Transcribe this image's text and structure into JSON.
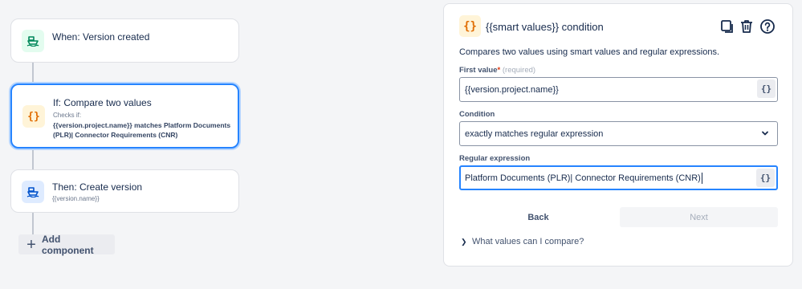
{
  "flow": {
    "trigger": {
      "title": "When: Version created",
      "icon": "version-ship-icon"
    },
    "condition": {
      "title": "If: Compare two values",
      "sub": "Checks if:",
      "desc": "{{version.project.name}} matches Platform Documents (PLR)| Connector Requirements (CNR)",
      "icon": "smart-values-icon",
      "icon_glyph": "{}"
    },
    "action": {
      "title": "Then: Create version",
      "sub": "{{version.name}}",
      "icon": "version-ship-icon"
    },
    "add_component": "Add component"
  },
  "panel": {
    "icon_glyph": "{}",
    "title": "{{smart values}} condition",
    "description": "Compares two values using smart values and regular expressions.",
    "first_value": {
      "label": "First value",
      "required_mark": "*",
      "hint": "(required)",
      "value": "{{version.project.name}}"
    },
    "condition": {
      "label": "Condition",
      "value": "exactly matches regular expression"
    },
    "regex": {
      "label": "Regular expression",
      "value": "Platform Documents (PLR)| Connector Requirements (CNR)"
    },
    "smart_button_glyph": "{}",
    "back": "Back",
    "next": "Next",
    "expander": "What values can I compare?"
  },
  "colors": {
    "accent": "#2684ff",
    "trigger_icon_bg": "#e3fcef",
    "trigger_icon": "#00875a",
    "condition_icon_bg": "#fff4d8",
    "condition_icon": "#e06c00",
    "action_icon_bg": "#deebff",
    "action_icon": "#0052cc"
  }
}
